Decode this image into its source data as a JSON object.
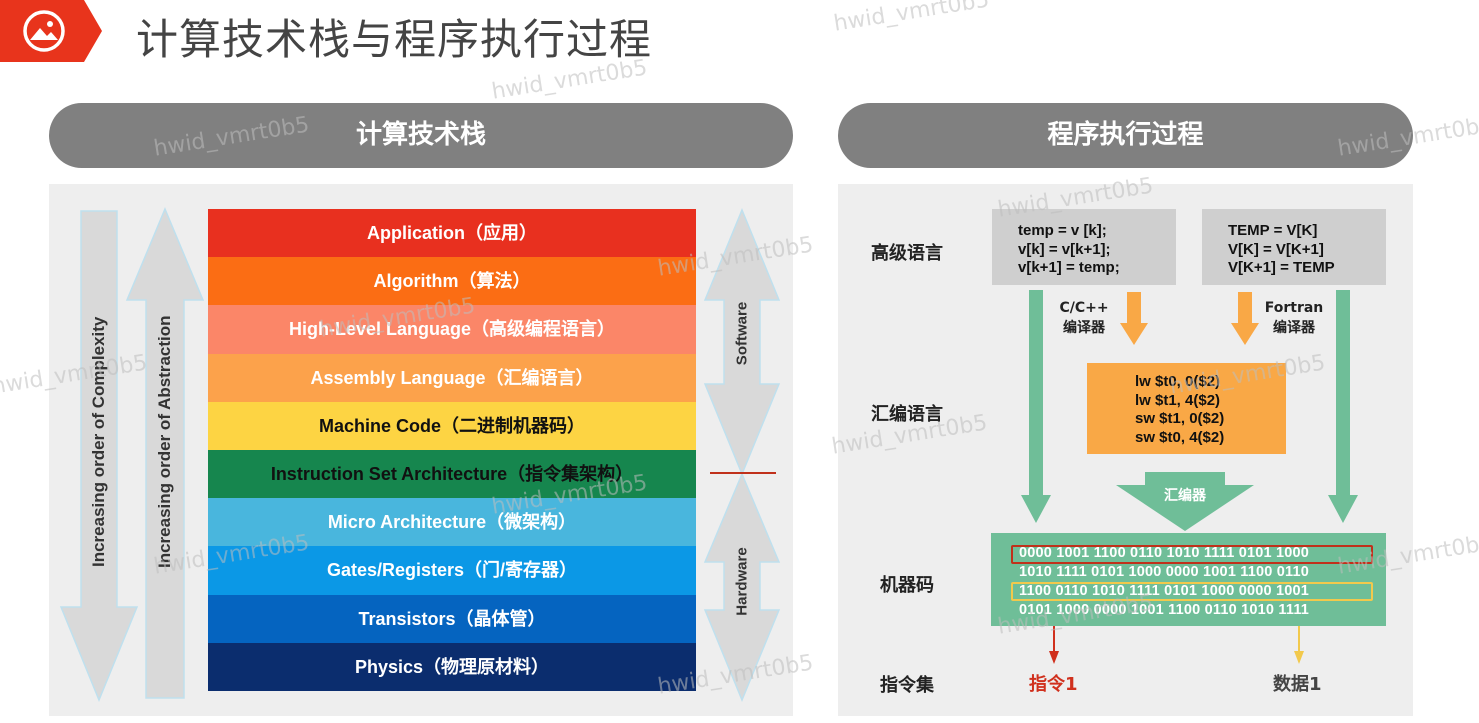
{
  "page": {
    "title": "计算技术栈与程序执行过程",
    "icon": "image-icon",
    "accent": "#e8341c"
  },
  "left": {
    "heading": "计算技术栈",
    "layers": [
      {
        "label": "Application（应用）",
        "color": "#e8301f",
        "text_color": "#ffffff"
      },
      {
        "label": "Algorithm（算法）",
        "color": "#fb6d14",
        "text_color": "#ffffff"
      },
      {
        "label": "High-Level Language（高级编程语言）",
        "color": "#fb8668",
        "text_color": "#ffffff"
      },
      {
        "label": "Assembly Language（汇编语言）",
        "color": "#fca24b",
        "text_color": "#ffffff"
      },
      {
        "label": "Machine Code（二进制机器码）",
        "color": "#fdd443",
        "text_color": "#111111"
      },
      {
        "label": "Instruction Set Architecture（指令集架构）",
        "color": "#16864e",
        "text_color": "#111111"
      },
      {
        "label": "Micro Architecture（微架构）",
        "color": "#49b6dd",
        "text_color": "#ffffff"
      },
      {
        "label": "Gates/Registers（门/寄存器）",
        "color": "#0b98e6",
        "text_color": "#ffffff"
      },
      {
        "label": "Transistors（晶体管）",
        "color": "#0564c0",
        "text_color": "#ffffff"
      },
      {
        "label": "Physics（物理原材料）",
        "color": "#0b2d6e",
        "text_color": "#ffffff"
      }
    ],
    "complexity_label": "Increasing order of Complexity",
    "abstraction_label": "Increasing order of Abstraction",
    "software_label": "Software",
    "hardware_label": "Hardware"
  },
  "right": {
    "heading": "程序执行过程",
    "row_labels": {
      "high_level": "高级语言",
      "assembly": "汇编语言",
      "machine": "机器码",
      "isa": "指令集"
    },
    "c_code": [
      "temp = v [k];",
      "v[k] = v[k+1];",
      "v[k+1] = temp;"
    ],
    "fortran_code": [
      "TEMP = V[K]",
      "V[K] = V[K+1]",
      "V[K+1] = TEMP"
    ],
    "c_compiler": [
      "C/C++",
      "编译器"
    ],
    "fortran_compiler": [
      "Fortran",
      "编译器"
    ],
    "assembly_code": [
      "lw $t0, 0($2)",
      "lw $t1, 4($2)",
      "sw $t1, 0($2)",
      "sw $t0, 4($2)"
    ],
    "assembler": "汇编器",
    "machine_code": [
      "0000 1001 1100 0110 1010 1111 0101 1000",
      "1010 1111 0101 1000 0000 1001 1100 0110",
      "1100 0110 1010 1111 0101 1000 0000 1001",
      "0101 1000 0000 1001 1100 0110 1010 1111"
    ],
    "instruction_label": "指令1",
    "data_label": "数据1",
    "instruction_color": "#d0301d",
    "data_color": "#f2c94c"
  },
  "watermark": "hwid_vmrt0b5"
}
